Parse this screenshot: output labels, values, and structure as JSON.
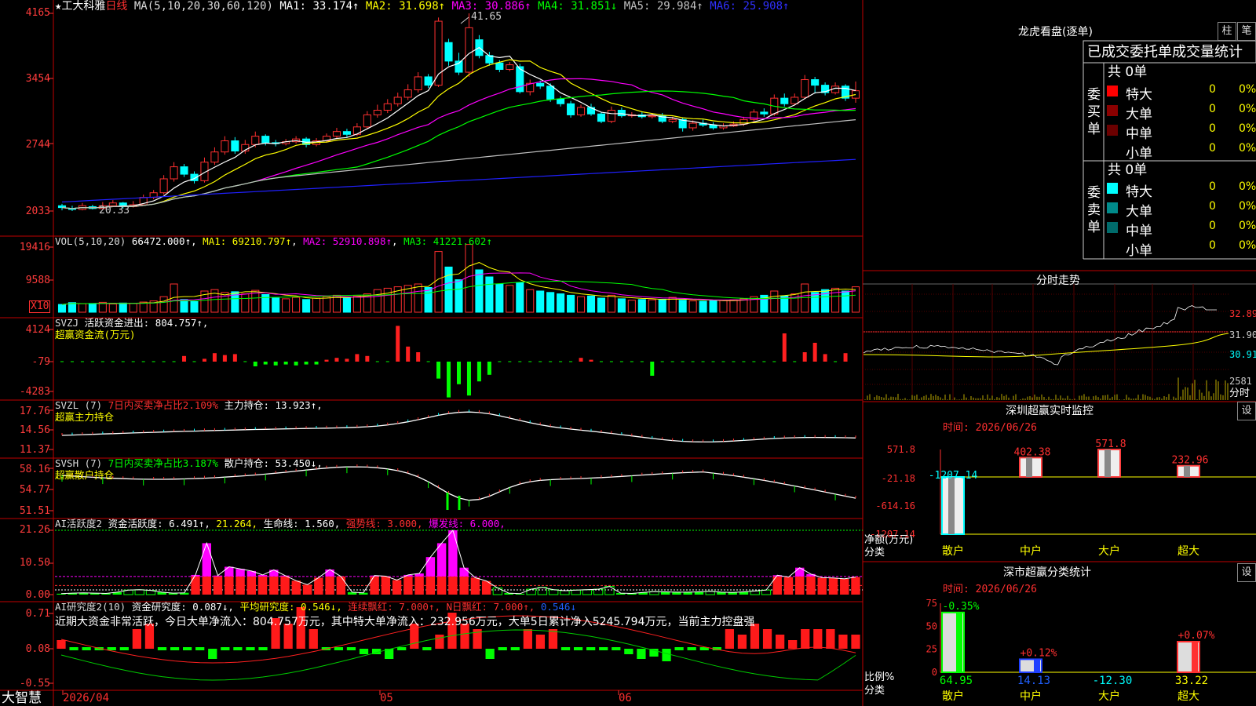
{
  "stock": {
    "star": "★",
    "name": "工大科雅",
    "period": "日线"
  },
  "ma_header": {
    "label": "MA(5,10,20,30,60,120)",
    "items": [
      {
        "text": "MA1: 33.174↑",
        "color": "#ffffff"
      },
      {
        "text": "MA2: 31.698↑",
        "color": "#ffff00"
      },
      {
        "text": "MA3: 30.886↑",
        "color": "#ff00ff"
      },
      {
        "text": "MA4: 31.851↓",
        "color": "#00ff00"
      },
      {
        "text": "MA5: 29.984↑",
        "color": "#c0c0c0"
      },
      {
        "text": "MA6: 25.908↑",
        "color": "#2020ff"
      }
    ]
  },
  "price_axis": [
    "4165",
    "3454",
    "2744",
    "2033"
  ],
  "price_marks": {
    "high": "41.65",
    "low": "20.33"
  },
  "vol_header": {
    "label": "VOL(5,10,20)",
    "value": "66472.000↑",
    "ma1": "MA1: 69210.797↑",
    "ma2": "MA2: 52910.898↑",
    "ma3": "MA3: 41221.602↑"
  },
  "vol_axis": [
    "19416",
    "9588"
  ],
  "vol_unit": "X10",
  "svzj_header": {
    "label": "SVZJ",
    "title": "活跃资金进出: 804.757↑,",
    "subtitle": "超赢资金流(万元)"
  },
  "svzj_axis": [
    "4124",
    "-79",
    "-4283"
  ],
  "svzl_header": {
    "label": "SVZL (7)",
    "pct": "7日内买卖净占比2.109%",
    "title": "主力持仓: 13.923↑,",
    "subtitle": "超赢主力持仓"
  },
  "svzl_axis": [
    "17.76",
    "14.56",
    "11.37"
  ],
  "svsh_header": {
    "label": "SVSH (7)",
    "pct": "7日内买卖净占比3.187%",
    "title": "散户持仓: 53.450↓,",
    "subtitle": "超赢散户持仓"
  },
  "svsh_axis": [
    "58.16",
    "54.77",
    "51.51"
  ],
  "ai1_header": {
    "label": "AI活跃度2",
    "v1": "资金活跃度: 6.491↑,",
    "v2": "21.264,",
    "v3": "生命线: 1.560,",
    "v4": "强势线: 3.000,",
    "v5": "爆发线: 6.000,"
  },
  "ai1_axis": [
    "21.26",
    "10.50",
    "0.00"
  ],
  "ai2_header": {
    "label": "AI研究度2(10)",
    "v1": "资金研究度: 0.087↓,",
    "v2": "平均研究度: 0.546↓,",
    "v3": "连续飘红: 7.000↑,",
    "v4": "N日飘红: 7.000↑,",
    "v5": "0.546↓"
  },
  "ai2_text": "近期大资金非常活跃，今日大单净流入：804.757万元，其中特大单净流入：232.956万元，大单5日累计净入5245.794万元，当前主力控盘强",
  "ai2_axis": [
    "0.71",
    "0.08",
    "-0.55"
  ],
  "bottom": {
    "brand": "大智慧",
    "date": "2026/04",
    "m05": "05",
    "m06": "06"
  },
  "right": {
    "longhu_title": "龙虎看盘(逐单)",
    "btn_zhu": "柱",
    "btn_bi": "笔",
    "table_header": "已成交委托单成交量统计",
    "buy_label": "委买单",
    "sell_label": "委卖单",
    "buy_total": "共 0单",
    "sell_total": "共 0单",
    "buy_rows": [
      {
        "name": "特大",
        "count": "0",
        "pct": "0%",
        "color": "#ff0000"
      },
      {
        "name": "大单",
        "count": "0",
        "pct": "0%",
        "color": "#8b0000"
      },
      {
        "name": "中单",
        "count": "0",
        "pct": "0%",
        "color": "#6b0000"
      },
      {
        "name": "小单",
        "count": "0",
        "pct": "0%",
        "color": ""
      }
    ],
    "sell_rows": [
      {
        "name": "特大",
        "count": "0",
        "pct": "0%",
        "color": "#00ffff"
      },
      {
        "name": "大单",
        "count": "0",
        "pct": "0%",
        "color": "#008b8b"
      },
      {
        "name": "中单",
        "count": "0",
        "pct": "0%",
        "color": "#006b6b"
      },
      {
        "name": "小单",
        "count": "0",
        "pct": "0%",
        "color": ""
      }
    ],
    "fenshi_title": "分时走势",
    "fenshi_axis": [
      "32.89",
      "31.90",
      "30.91"
    ],
    "fenshi_vol": "2581",
    "fenshi_unit": "分时",
    "sz_title": "深圳超赢实时监控",
    "btn_set": "设",
    "time_label": "时间: 2026/06/26",
    "sz_axis": [
      "571.8",
      "-21.18",
      "-614.16",
      "-1207.14"
    ],
    "sz_bars": [
      {
        "cat": "散户",
        "value": -1207.14,
        "label": "-1207.14",
        "color": "#00ffff"
      },
      {
        "cat": "中户",
        "value": 402.38,
        "label": "402.38",
        "color": "#ff4040"
      },
      {
        "cat": "大户",
        "value": 571.8,
        "label": "571.8",
        "color": "#ff4040"
      },
      {
        "cat": "超大",
        "value": 232.96,
        "label": "232.96",
        "color": "#ff4040"
      }
    ],
    "sz_ylabel": "净额(万元)",
    "sz_xlabel": "分类",
    "cls_title": "深市超赢分类统计",
    "cls_time": "时间: 2026/06/26",
    "cls_axis": [
      "75",
      "50",
      "25",
      "0"
    ],
    "cls_bars": [
      {
        "cat": "散户",
        "ratio": 64.95,
        "pct": "-0.35%",
        "val": "64.95",
        "color": "#00ff00",
        "valColor": "#00ff00"
      },
      {
        "cat": "中户",
        "ratio": 14.13,
        "pct": "+0.12%",
        "val": "14.13",
        "color": "#2040ff",
        "valColor": "#2060ff"
      },
      {
        "cat": "大户",
        "ratio": 0,
        "pct": "",
        "val": "-12.30",
        "color": "#00ffff",
        "valColor": "#00ffff"
      },
      {
        "cat": "超大",
        "ratio": 33.22,
        "pct": "+0.07%",
        "val": "33.22",
        "color": "#ff3030",
        "valColor": "#ffff00"
      }
    ],
    "cls_ylabel": "比例%",
    "cls_xlabel": "分类"
  },
  "chart_data": {
    "type": "candlestick",
    "title": "工大科雅 日线",
    "x_ticks": [
      "2026/04",
      "05",
      "06"
    ],
    "ylim": [
      20.33,
      41.65
    ],
    "high": 41.65,
    "low": 20.33,
    "candles": [
      [
        20.9,
        20.7,
        21.1,
        20.4
      ],
      [
        20.6,
        20.5,
        20.9,
        20.33
      ],
      [
        20.5,
        20.9,
        21.2,
        20.4
      ],
      [
        20.8,
        20.6,
        21.0,
        20.5
      ],
      [
        20.6,
        20.9,
        21.3,
        20.5
      ],
      [
        20.9,
        21.2,
        21.5,
        20.8
      ],
      [
        21.2,
        20.8,
        21.3,
        20.6
      ],
      [
        20.8,
        21.0,
        21.4,
        20.7
      ],
      [
        21.0,
        21.8,
        22.1,
        20.9
      ],
      [
        21.8,
        22.3,
        22.6,
        21.6
      ],
      [
        22.3,
        23.8,
        24.2,
        22.1
      ],
      [
        23.8,
        25.1,
        25.6,
        23.5
      ],
      [
        25.1,
        24.3,
        25.4,
        24.0
      ],
      [
        24.3,
        23.6,
        24.6,
        23.3
      ],
      [
        23.6,
        25.6,
        26.1,
        23.4
      ],
      [
        25.6,
        26.7,
        27.2,
        25.3
      ],
      [
        26.7,
        27.9,
        28.4,
        26.4
      ],
      [
        27.9,
        26.8,
        28.3,
        26.5
      ],
      [
        26.8,
        27.5,
        28.0,
        26.5
      ],
      [
        27.5,
        28.4,
        28.9,
        27.2
      ],
      [
        28.4,
        27.7,
        28.6,
        27.4
      ],
      [
        27.7,
        27.6,
        28.0,
        27.3
      ],
      [
        27.6,
        27.8,
        28.1,
        27.4
      ],
      [
        27.8,
        28.1,
        28.4,
        27.6
      ],
      [
        28.1,
        27.5,
        28.3,
        27.2
      ],
      [
        27.5,
        27.9,
        28.2,
        27.3
      ],
      [
        27.9,
        28.4,
        28.7,
        27.7
      ],
      [
        28.4,
        28.9,
        29.3,
        28.2
      ],
      [
        28.9,
        28.6,
        29.2,
        28.3
      ],
      [
        28.6,
        29.4,
        29.8,
        28.4
      ],
      [
        29.4,
        30.7,
        31.1,
        29.2
      ],
      [
        30.7,
        31.2,
        31.8,
        30.4
      ],
      [
        31.2,
        31.9,
        32.4,
        30.9
      ],
      [
        31.9,
        32.6,
        33.1,
        31.6
      ],
      [
        32.6,
        33.4,
        34.0,
        32.3
      ],
      [
        33.4,
        34.8,
        35.3,
        33.1
      ],
      [
        34.8,
        33.9,
        35.1,
        33.6
      ],
      [
        33.9,
        40.8,
        41.2,
        33.7
      ],
      [
        38.5,
        36.5,
        38.9,
        36.0
      ],
      [
        36.5,
        35.3,
        37.4,
        35.0
      ],
      [
        35.3,
        40.1,
        41.65,
        34.8
      ],
      [
        38.8,
        37.1,
        39.3,
        36.8
      ],
      [
        37.1,
        36.3,
        37.5,
        36.0
      ],
      [
        36.3,
        35.6,
        36.6,
        35.3
      ],
      [
        35.6,
        36.1,
        36.4,
        35.4
      ],
      [
        35.9,
        33.2,
        36.2,
        33.0
      ],
      [
        33.2,
        34.1,
        34.5,
        32.8
      ],
      [
        34.1,
        33.8,
        34.4,
        33.5
      ],
      [
        33.8,
        32.4,
        34.1,
        32.1
      ],
      [
        32.4,
        31.9,
        32.7,
        31.6
      ],
      [
        31.9,
        30.7,
        32.2,
        30.4
      ],
      [
        30.7,
        31.5,
        31.8,
        30.5
      ],
      [
        31.5,
        30.8,
        31.9,
        30.6
      ],
      [
        30.8,
        30.0,
        31.0,
        29.8
      ],
      [
        30.0,
        31.2,
        31.6,
        29.8
      ],
      [
        31.2,
        30.6,
        31.5,
        30.4
      ],
      [
        30.6,
        30.7,
        31.0,
        30.4
      ],
      [
        30.7,
        30.5,
        31.0,
        30.3
      ],
      [
        30.5,
        30.6,
        30.9,
        30.3
      ],
      [
        30.6,
        30.0,
        30.9,
        29.8
      ],
      [
        30.0,
        30.2,
        30.5,
        29.8
      ],
      [
        30.2,
        29.3,
        30.4,
        28.9
      ],
      [
        29.3,
        29.8,
        30.1,
        29.0
      ],
      [
        29.8,
        29.6,
        30.2,
        29.4
      ],
      [
        29.6,
        29.3,
        29.9,
        29.1
      ],
      [
        29.3,
        29.5,
        29.8,
        29.1
      ],
      [
        29.5,
        29.7,
        30.0,
        29.4
      ],
      [
        29.7,
        30.2,
        30.5,
        29.5
      ],
      [
        30.2,
        31.0,
        31.3,
        30.0
      ],
      [
        31.0,
        30.8,
        31.4,
        30.5
      ],
      [
        30.8,
        32.5,
        32.9,
        30.6
      ],
      [
        32.5,
        31.9,
        33.0,
        31.6
      ],
      [
        31.9,
        32.6,
        33.0,
        31.7
      ],
      [
        32.6,
        34.5,
        35.0,
        32.4
      ],
      [
        34.5,
        33.9,
        34.8,
        33.0
      ],
      [
        33.9,
        33.1,
        34.2,
        32.8
      ],
      [
        33.1,
        33.8,
        34.2,
        32.9
      ],
      [
        33.8,
        32.5,
        34.0,
        32.2
      ],
      [
        32.5,
        33.3,
        34.3,
        32.0
      ]
    ],
    "ma_series": [
      {
        "name": "MA1",
        "color": "#ffffff",
        "last": 33.174
      },
      {
        "name": "MA2",
        "color": "#ffff00",
        "last": 31.698
      },
      {
        "name": "MA3",
        "color": "#ff00ff",
        "last": 30.886
      },
      {
        "name": "MA4",
        "color": "#00ff00",
        "last": 31.851
      },
      {
        "name": "MA5",
        "color": "#c0c0c0",
        "last": 29.984
      },
      {
        "name": "MA6",
        "color": "#2020ff",
        "last": 25.908
      }
    ],
    "volume": [
      55,
      68,
      60,
      62,
      70,
      58,
      65,
      62,
      72,
      80,
      110,
      200,
      90,
      75,
      150,
      160,
      140,
      145,
      130,
      155,
      125,
      100,
      95,
      105,
      90,
      100,
      110,
      120,
      100,
      115,
      130,
      160,
      170,
      180,
      190,
      200,
      175,
      430,
      320,
      230,
      480,
      300,
      250,
      200,
      190,
      210,
      160,
      150,
      140,
      130,
      120,
      110,
      115,
      100,
      120,
      95,
      85,
      90,
      88,
      92,
      105,
      85,
      80,
      78,
      82,
      84,
      88,
      95,
      110,
      120,
      150,
      115,
      130,
      200,
      140,
      160,
      170,
      150,
      180
    ],
    "svzj": [
      0,
      0,
      0,
      0,
      0,
      0,
      0,
      0,
      0,
      0,
      0,
      0,
      0.6,
      0,
      0.3,
      0.9,
      0.7,
      0.8,
      0,
      -0.5,
      -0.3,
      -0.4,
      -0.3,
      -0.4,
      -0.3,
      -0.3,
      0.2,
      0.4,
      0.3,
      0.8,
      0.6,
      0,
      0,
      3.8,
      1.6,
      1.0,
      0,
      -1.8,
      -3.8,
      -2.4,
      -3.6,
      -2.1,
      -1.4,
      0,
      0,
      0,
      0,
      0,
      0,
      0,
      0,
      0.4,
      0.2,
      0,
      0,
      0,
      0,
      0,
      -1.5,
      0,
      0,
      0,
      0,
      0,
      0,
      0,
      0,
      0,
      0,
      0,
      0,
      3.0,
      0,
      1.0,
      2.0,
      0.8,
      0,
      0.9
    ],
    "svzl_last": 13.923,
    "svsh_last": 53.45,
    "ai1": [
      0.3,
      0.5,
      0.6,
      0.5,
      0.4,
      0.8,
      1.5,
      1.6,
      1.4,
      0.8,
      0.5,
      0.6,
      6.5,
      17,
      6.3,
      9.2,
      8.5,
      7.8,
      6.5,
      8.2,
      6.3,
      4.6,
      3.3,
      5.6,
      8.3,
      6.0,
      0.8,
      0.6,
      6.3,
      6.1,
      4.8,
      6.5,
      7.0,
      12.4,
      17,
      21.26,
      8.9,
      5.6,
      4.5,
      2.2,
      0.5,
      0.3,
      1.8,
      2.4,
      1.6,
      1.3,
      1.5,
      1.6,
      1.8,
      2.7,
      0.5,
      0.4,
      0.7,
      1.0,
      0.9,
      0.8,
      0.8,
      0.9,
      1.1,
      0.8,
      0.7,
      0.9,
      1.2,
      1.5,
      6.4,
      5.8,
      8.9,
      6.8,
      5.6,
      5.5,
      5.2,
      5.8
    ],
    "ai2": [
      0.1,
      0,
      0,
      0,
      0,
      0,
      0.3,
      0.4,
      0,
      0,
      0,
      0,
      -0.3,
      0,
      0,
      0,
      0,
      0.5,
      0.4,
      0.7,
      0.3,
      0,
      0,
      0,
      -0.1,
      -0.1,
      -0.3,
      0,
      0.4,
      0,
      0.2,
      0.6,
      0.4,
      0.3,
      -0.3,
      0,
      0,
      0.3,
      0.2,
      0.3,
      0,
      0,
      0,
      0,
      0,
      -0.1,
      -0.3,
      -0.2,
      -0.4,
      0,
      0,
      0,
      0,
      0.3,
      0.2,
      0.4,
      0.3,
      0.2,
      0.1,
      0.3,
      0.3,
      0.3,
      0.2,
      0.2
    ]
  }
}
